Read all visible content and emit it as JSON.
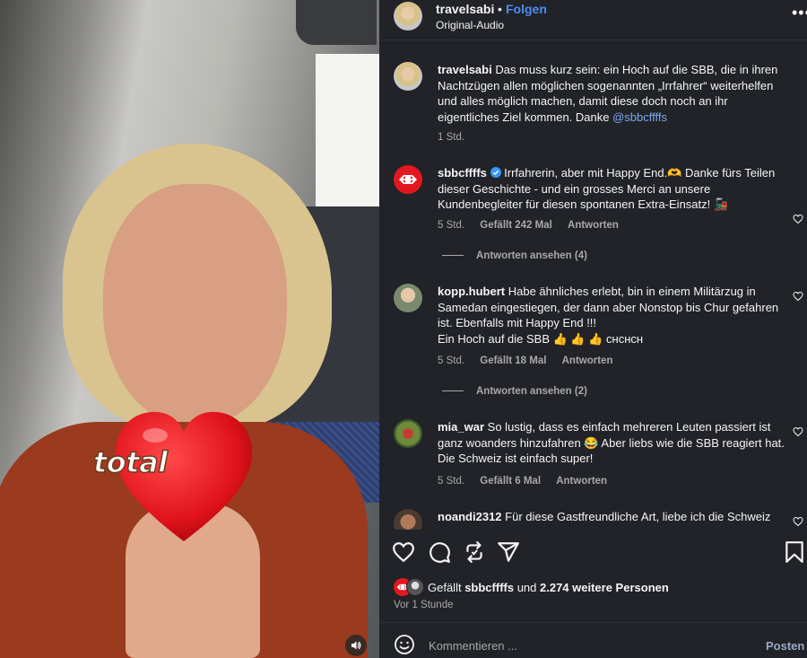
{
  "video": {
    "sticker_text": "total",
    "icons": {
      "mute": "speaker-icon",
      "heart": "heart-icon"
    }
  },
  "header": {
    "username": "travelsabi",
    "separator": "•",
    "follow_label": "Folgen",
    "audio_label": "Original-Audio",
    "more_icon": "more-horizontal-icon"
  },
  "comments": [
    {
      "username": "travelsabi",
      "text": "Das muss kurz sein: ein Hoch auf die SBB, die in ihren Nachtzügen allen möglichen sogenannten „Irrfahrer“ weiterhelfen und alles möglich machen, damit diese doch noch an ihr eigentliches Ziel kommen. Danke ",
      "mention": "@sbbcffffs",
      "time": "1 Std."
    },
    {
      "username": "sbbcffffs",
      "verified": true,
      "text": "Irrfahrerin, aber mit Happy End.🫶 Danke fürs Teilen dieser Geschichte - und ein grosses Merci an unsere Kundenbegleiter für diesen spontanen Extra-Einsatz! 🚂",
      "time": "5 Std.",
      "likes": "Gefällt 242 Mal",
      "reply_label": "Antworten",
      "view_replies": "Antworten ansehen (4)"
    },
    {
      "username": "kopp.hubert",
      "text": "Habe ähnliches erlebt, bin in einem Militärzug in Samedan eingestiegen, der dann aber Nonstop bis Chur gefahren ist. Ebenfalls mit Happy End !!!",
      "text2": "Ein Hoch auf die SBB 👍 👍 👍 ᴄʜᴄʜᴄʜ",
      "time": "5 Std.",
      "likes": "Gefällt 18 Mal",
      "reply_label": "Antworten",
      "view_replies": "Antworten ansehen (2)"
    },
    {
      "username": "mia_war",
      "text": "So lustig, dass es einfach mehreren Leuten passiert ist ganz woanders hinzufahren 😂 Aber liebs wie die SBB reagiert hat. Die Schweiz ist einfach super!",
      "time": "5 Std.",
      "likes": "Gefällt 6 Mal",
      "reply_label": "Antworten"
    },
    {
      "username": "noandi2312",
      "text": "Für diese Gastfreundliche Art, liebe ich die Schweiz"
    }
  ],
  "actions": {
    "icons": [
      "heart-icon",
      "comment-icon",
      "repost-icon",
      "share-icon",
      "bookmark-icon"
    ]
  },
  "likes_summary": {
    "prefix": "Gefällt ",
    "user": "sbbcffffs",
    "middle": " und ",
    "others": "2.274 weitere Personen"
  },
  "post_time": "Vor 1 Stunde",
  "composer": {
    "placeholder": "Kommentieren ...",
    "post_label": "Posten",
    "emoji_icon": "smiley-icon"
  },
  "colors": {
    "panel_bg": "#212328",
    "link": "#4f8bf5",
    "mention": "#7ea7ee",
    "muted": "#a8a8a8",
    "sbb_red": "#e3171f"
  }
}
